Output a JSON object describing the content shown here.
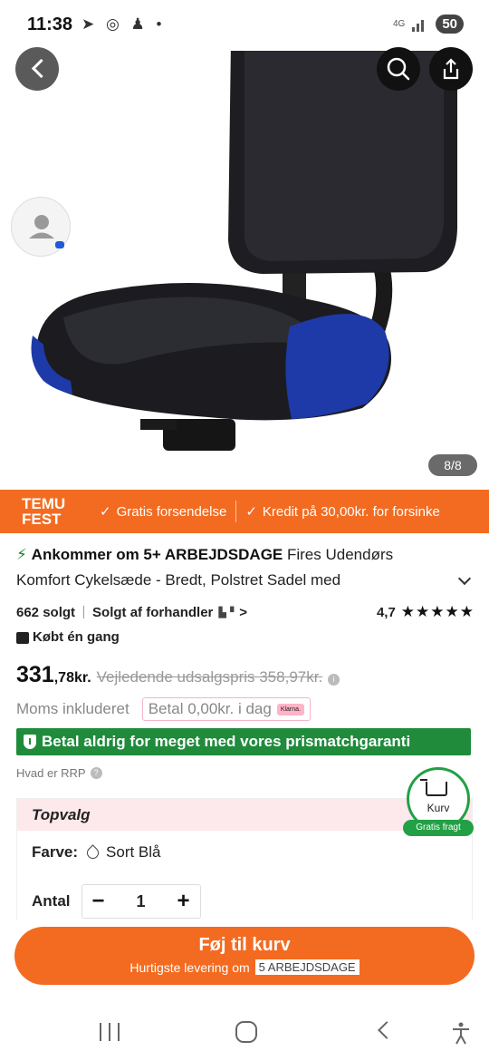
{
  "status_bar": {
    "time": "11:38",
    "network": "4G",
    "battery": "50"
  },
  "gallery": {
    "image_counter": "8/8"
  },
  "promo_bar": {
    "logo_line1": "TEMU",
    "logo_line2": "FEST",
    "items": [
      "Gratis forsendelse",
      "Kredit på 30,00kr. for forsinke"
    ]
  },
  "product": {
    "delivery_badge": "Ankommer om 5+ ARBEJDSDAGE",
    "title": "Fires Udendørs Komfort Cykelsæde - Bredt, Polstret Sadel med",
    "sold_count": "662 solgt",
    "seller": "Solgt af forhandler",
    "rating": "4,7",
    "stars": "★★★★★",
    "bought_once": "Købt én gang"
  },
  "price": {
    "main": "331",
    "decimal": ",78kr.",
    "rrp": "Vejledende udsalgspris 358,97kr.",
    "vat": "Moms inkluderet",
    "pay_today": "Betal 0,00kr. i dag",
    "klarna": "Klarna."
  },
  "guarantee": {
    "text": "Betal aldrig for meget med vores prismatchgaranti"
  },
  "rrp_help": "Hvad er RRP",
  "options": {
    "header": "Topvalg",
    "color_label": "Farve:",
    "color_value": "Sort Blå",
    "qty_label": "Antal",
    "qty_minus": "−",
    "qty_value": "1",
    "qty_plus": "+"
  },
  "cart_float": {
    "label": "Kurv",
    "free_shipping": "Gratis fragt"
  },
  "cta": {
    "button": "Føj til kurv",
    "sub_prefix": "Hurtigste levering om",
    "sub_days": "5 ARBEJDSDAGE"
  },
  "colors": {
    "brand_orange": "#f36b21",
    "guarantee_green": "#1f8b3b"
  }
}
